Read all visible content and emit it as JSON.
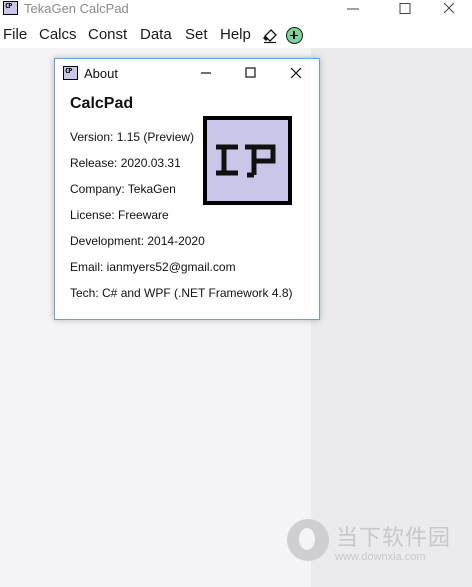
{
  "window": {
    "title": "TekaGen CalcPad",
    "icon_text": "CP"
  },
  "menu": {
    "items": [
      "File",
      "Calcs",
      "Const",
      "Data",
      "Set",
      "Help"
    ],
    "tools": [
      "eraser-icon",
      "add-circle-icon"
    ]
  },
  "about": {
    "title": "About",
    "app_name": "CalcPad",
    "version": "Version: 1.15 (Preview)",
    "release": "Release: 2020.03.31",
    "company": "Company: TekaGen",
    "license": "License: Freeware",
    "development": "Development: 2014-2020",
    "email": "Email: ianmyers52@gmail.com",
    "tech": "Tech: C# and WPF (.NET Framework 4.8)"
  },
  "watermark": {
    "brand": "当下软件园",
    "url": "www.downxia.com"
  },
  "colors": {
    "logo_fill": "#c9c6ea",
    "dialog_border": "#6aa0d8",
    "add_button": "#7ed39a"
  }
}
